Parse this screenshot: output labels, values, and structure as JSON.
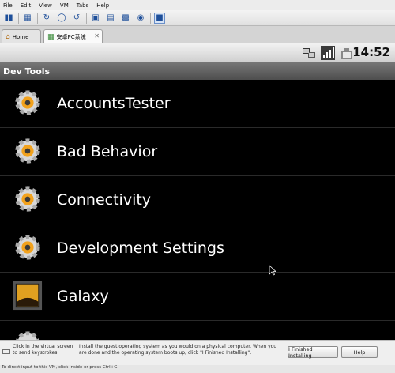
{
  "menu": {
    "items": [
      "File",
      "Edit",
      "View",
      "VM",
      "Tabs",
      "Help"
    ]
  },
  "toolbar": {
    "icons": [
      "play-pause-icon",
      "network-icon",
      "revert-snapshot-icon",
      "snapshot-icon",
      "manage-snapshots-icon",
      "quick-switch-icon",
      "normal-view-icon",
      "fullscreen-icon",
      "unity-icon",
      "console-view-icon"
    ]
  },
  "tabs": [
    {
      "label": "Home"
    },
    {
      "label": "安卓PC系统"
    }
  ],
  "android": {
    "time": "14:52",
    "title": "Dev Tools",
    "items": [
      {
        "label": "AccountsTester",
        "icon": "gear-icon"
      },
      {
        "label": "Bad Behavior",
        "icon": "gear-icon"
      },
      {
        "label": "Connectivity",
        "icon": "gear-icon"
      },
      {
        "label": "Development Settings",
        "icon": "gear-icon"
      },
      {
        "label": "Galaxy",
        "icon": "galaxy-wallpaper-icon"
      }
    ]
  },
  "hint": {
    "left": "Click in the virtual screen to send keystrokes",
    "main": "Install the guest operating system as you would on a physical computer. When you are done and the operating system boots up, click \"I Finished Installing\".",
    "finished_button": "I Finished Installing",
    "help_button": "Help"
  },
  "statusline": "To direct input to this VM, click inside or press Ctrl+G."
}
